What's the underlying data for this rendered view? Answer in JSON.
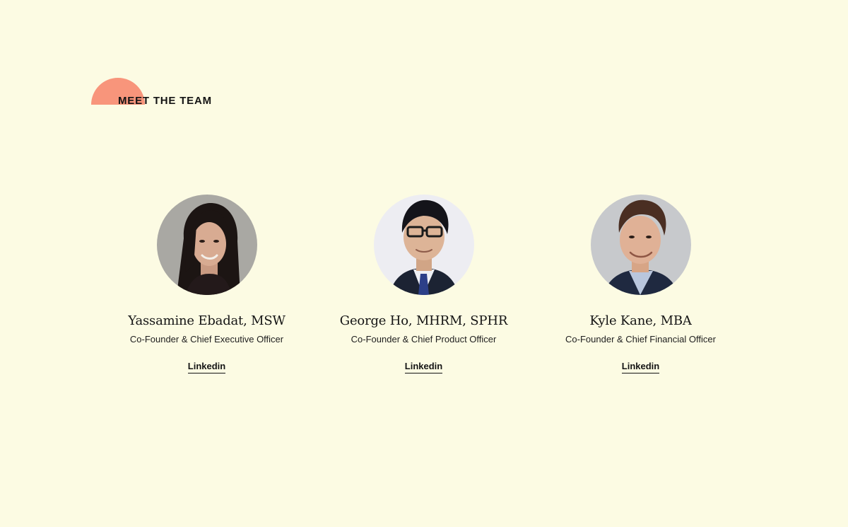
{
  "section": {
    "title": "MEET THE TEAM",
    "accent_color": "#f8957b",
    "background_color": "#fcfbe3"
  },
  "team": [
    {
      "name": "Yassamine Ebadat, MSW",
      "role": "Co-Founder & Chief Executive Officer",
      "link_label": "Linkedin"
    },
    {
      "name": "George Ho, MHRM, SPHR",
      "role": "Co-Founder & Chief Product Officer",
      "link_label": "Linkedin"
    },
    {
      "name": "Kyle Kane, MBA",
      "role": "Co-Founder & Chief Financial Officer",
      "link_label": "Linkedin"
    }
  ]
}
